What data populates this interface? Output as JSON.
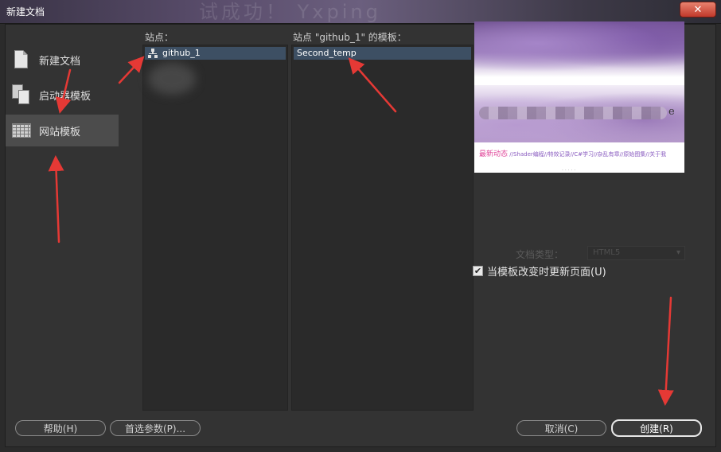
{
  "window": {
    "title": "新建文档",
    "background_caption": "试成功！ Yxping",
    "close_label": "✕"
  },
  "categories": [
    {
      "label": "新建文档",
      "icon": "blank-document-icon",
      "selected": false
    },
    {
      "label": "启动器模板",
      "icon": "starter-template-icon",
      "selected": false
    },
    {
      "label": "网站模板",
      "icon": "site-template-icon",
      "selected": true
    }
  ],
  "sites": {
    "label": "站点：",
    "items": [
      {
        "label": "github_1",
        "icon": "site-icon",
        "selected": true
      }
    ]
  },
  "templates": {
    "label": "站点 \"github_1\" 的模板：",
    "items": [
      {
        "label": "Second_temp",
        "selected": true
      }
    ]
  },
  "preview": {
    "trailing_letter": "e",
    "news_heading": "最新动态",
    "news_links": "//Shader编程//特效记录//C#学习//杂乱有章//原始图集//关于我",
    "footer": "· · · · ·"
  },
  "doctype": {
    "label": "文档类型：",
    "value": "HTML5",
    "enabled": false
  },
  "update_on_change": {
    "label": "当模板改变时更新页面(U)",
    "checked": true
  },
  "buttons": {
    "help": "帮助(H)",
    "preferences": "首选参数(P)...",
    "cancel": "取消(C)",
    "create": "创建(R)"
  },
  "colors": {
    "background": "#333333",
    "selection": "#3d4f63",
    "annotation_arrow": "#e53935"
  }
}
